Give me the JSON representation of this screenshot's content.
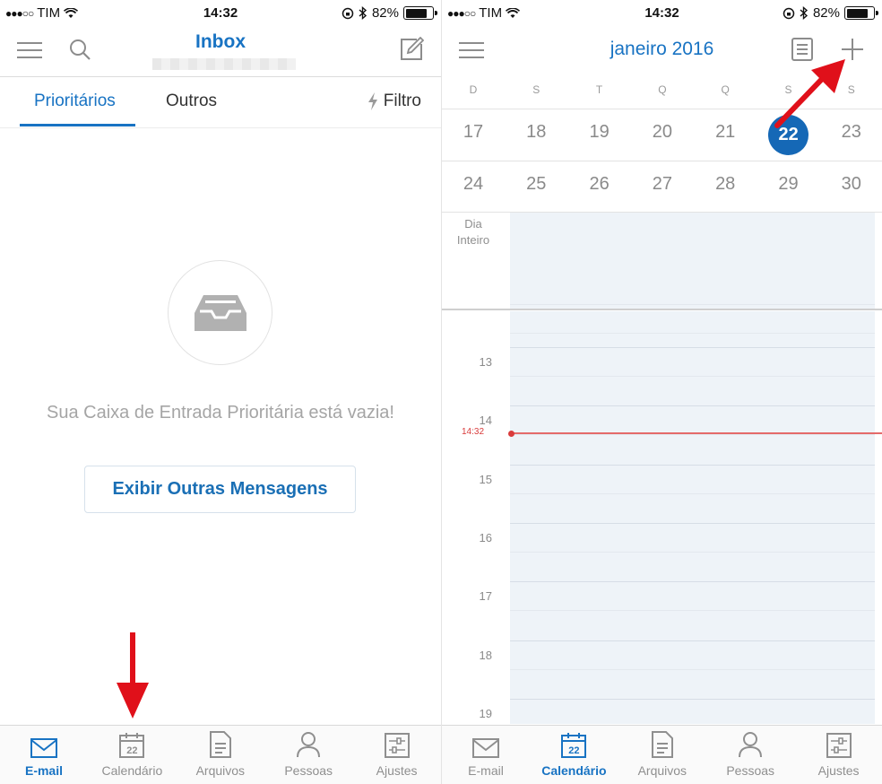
{
  "left": {
    "status": {
      "carrier": "TIM",
      "time": "14:32",
      "battery": "82%",
      "battery_level": 0.82,
      "signal_icon": "signal-icon",
      "wifi_icon": "wifi-icon",
      "lock_icon": "orientation-lock-icon",
      "bt_icon": "bluetooth-icon"
    },
    "header": {
      "title": "Inbox"
    },
    "tabs": {
      "focused": "Prioritários",
      "other": "Outros",
      "filter": "Filtro"
    },
    "empty": {
      "message": "Sua Caixa de Entrada Prioritária está vazia!",
      "button": "Exibir Outras Mensagens"
    },
    "tabbar": [
      {
        "label": "E-mail",
        "icon": "mail-icon",
        "active": true
      },
      {
        "label": "Calendário",
        "icon": "calendar-icon",
        "day": "22",
        "active": false
      },
      {
        "label": "Arquivos",
        "icon": "file-icon",
        "active": false
      },
      {
        "label": "Pessoas",
        "icon": "person-icon",
        "active": false
      },
      {
        "label": "Ajustes",
        "icon": "settings-icon",
        "active": false
      }
    ]
  },
  "right": {
    "status": {
      "carrier": "TIM",
      "time": "14:32",
      "battery": "82%",
      "battery_level": 0.82
    },
    "header": {
      "title": "janeiro 2016"
    },
    "weekdays": [
      "D",
      "S",
      "T",
      "Q",
      "Q",
      "S",
      "S"
    ],
    "weeks": [
      [
        "17",
        "18",
        "19",
        "20",
        "21",
        "22",
        "23"
      ],
      [
        "24",
        "25",
        "26",
        "27",
        "28",
        "29",
        "30"
      ]
    ],
    "today": "22",
    "allday_label": "Dia Inteiro",
    "hours": [
      "13",
      "14",
      "15",
      "16",
      "17",
      "18",
      "19"
    ],
    "now_label": "14:32",
    "tabbar": [
      {
        "label": "E-mail",
        "icon": "mail-icon",
        "active": false
      },
      {
        "label": "Calendário",
        "icon": "calendar-icon",
        "day": "22",
        "active": true
      },
      {
        "label": "Arquivos",
        "icon": "file-icon",
        "active": false
      },
      {
        "label": "Pessoas",
        "icon": "person-icon",
        "active": false
      },
      {
        "label": "Ajustes",
        "icon": "settings-icon",
        "active": false
      }
    ]
  },
  "colors": {
    "accent": "#1873c3",
    "today": "#1568b6",
    "now": "#e46a6a",
    "annotation_arrow": "#e0101a"
  }
}
